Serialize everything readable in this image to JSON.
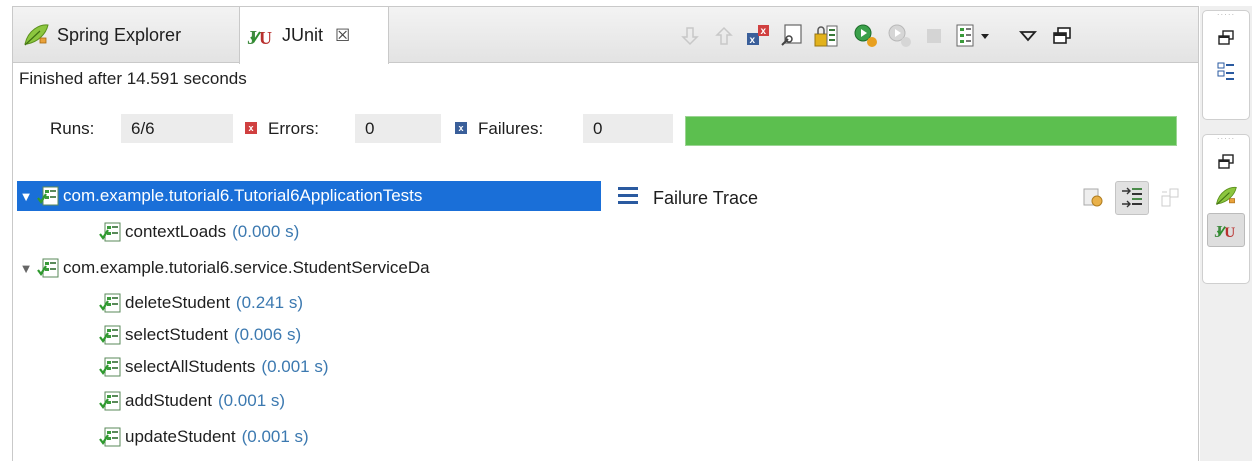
{
  "tabs": {
    "spring_explorer": "Spring Explorer",
    "junit": "JUnit",
    "close_glyph": "☒"
  },
  "status": {
    "finished": "Finished after 14.591 seconds"
  },
  "counters": {
    "runs_label": "Runs:",
    "runs_value": "6/6",
    "errors_label": "Errors:",
    "errors_value": "0",
    "failures_label": "Failures:",
    "failures_value": "0",
    "progress_fraction": 1.0,
    "progress_color": "#5cbf4f"
  },
  "tree": {
    "suite1": {
      "name": "com.example.tutorial6.Tutorial6ApplicationTests",
      "tests": [
        {
          "name": "contextLoads",
          "time": "(0.000 s)"
        }
      ]
    },
    "suite2": {
      "name": "com.example.tutorial6.service.StudentServiceDa",
      "tests": [
        {
          "name": "deleteStudent",
          "time": "(0.241 s)"
        },
        {
          "name": "selectStudent",
          "time": "(0.006 s)"
        },
        {
          "name": "selectAllStudents",
          "time": "(0.001 s)"
        },
        {
          "name": "addStudent",
          "time": "(0.001 s)"
        },
        {
          "name": "updateStudent",
          "time": "(0.001 s)"
        }
      ]
    }
  },
  "trace": {
    "title": "Failure Trace"
  },
  "colors": {
    "selection": "#1a6fd8",
    "time_text": "#3c79b0",
    "error_red": "#d04040",
    "failure_blue": "#3a5f9a"
  }
}
